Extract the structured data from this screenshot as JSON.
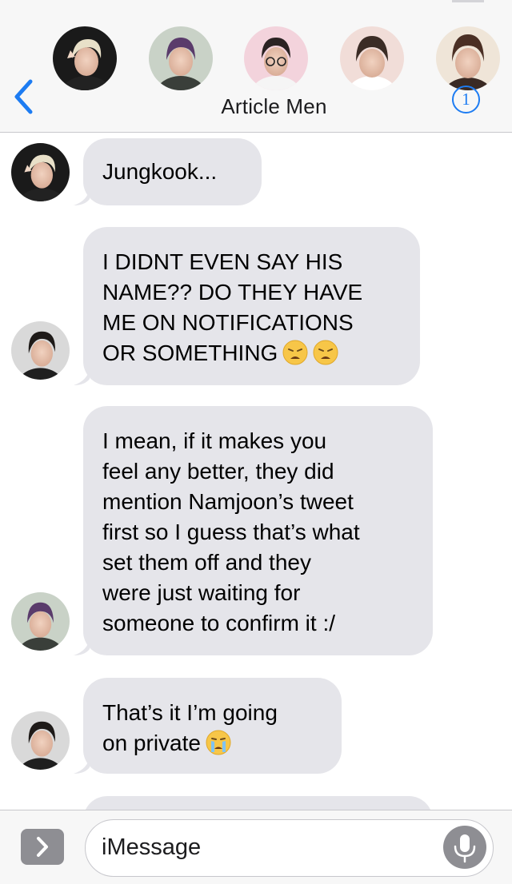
{
  "header": {
    "group_name": "Article Men",
    "info_badge": "1",
    "participants": [
      {
        "icon": "avatar-person-1"
      },
      {
        "icon": "avatar-person-2"
      },
      {
        "icon": "avatar-person-3"
      },
      {
        "icon": "avatar-person-4"
      },
      {
        "icon": "avatar-person-5"
      }
    ]
  },
  "messages": [
    {
      "text": "Jungkook...",
      "sender_icon": "avatar-person-1"
    },
    {
      "text": "I DIDNT EVEN SAY HIS\nNAME?? DO THEY HAVE\nME ON NOTIFICATIONS\nOR SOMETHING",
      "emoji": [
        "weary-face-emoji",
        "weary-face-emoji"
      ],
      "sender_icon": "avatar-person-6"
    },
    {
      "text": "I mean, if it makes you\nfeel any better, they did\nmention Namjoon’s tweet\nfirst so I guess that’s what\nset them off and they\nwere just waiting for\nsomeone to confirm it :/",
      "sender_icon": "avatar-person-2"
    },
    {
      "text": "That’s it I’m going\non private",
      "emoji": [
        "crying-face-emoji"
      ],
      "sender_icon": "avatar-person-6"
    }
  ],
  "composer": {
    "placeholder": "iMessage"
  },
  "colors": {
    "accent": "#1d7cf2",
    "bubble": "#e5e5ea",
    "bar": "#f7f7f7",
    "button_gray": "#8e8e93"
  }
}
